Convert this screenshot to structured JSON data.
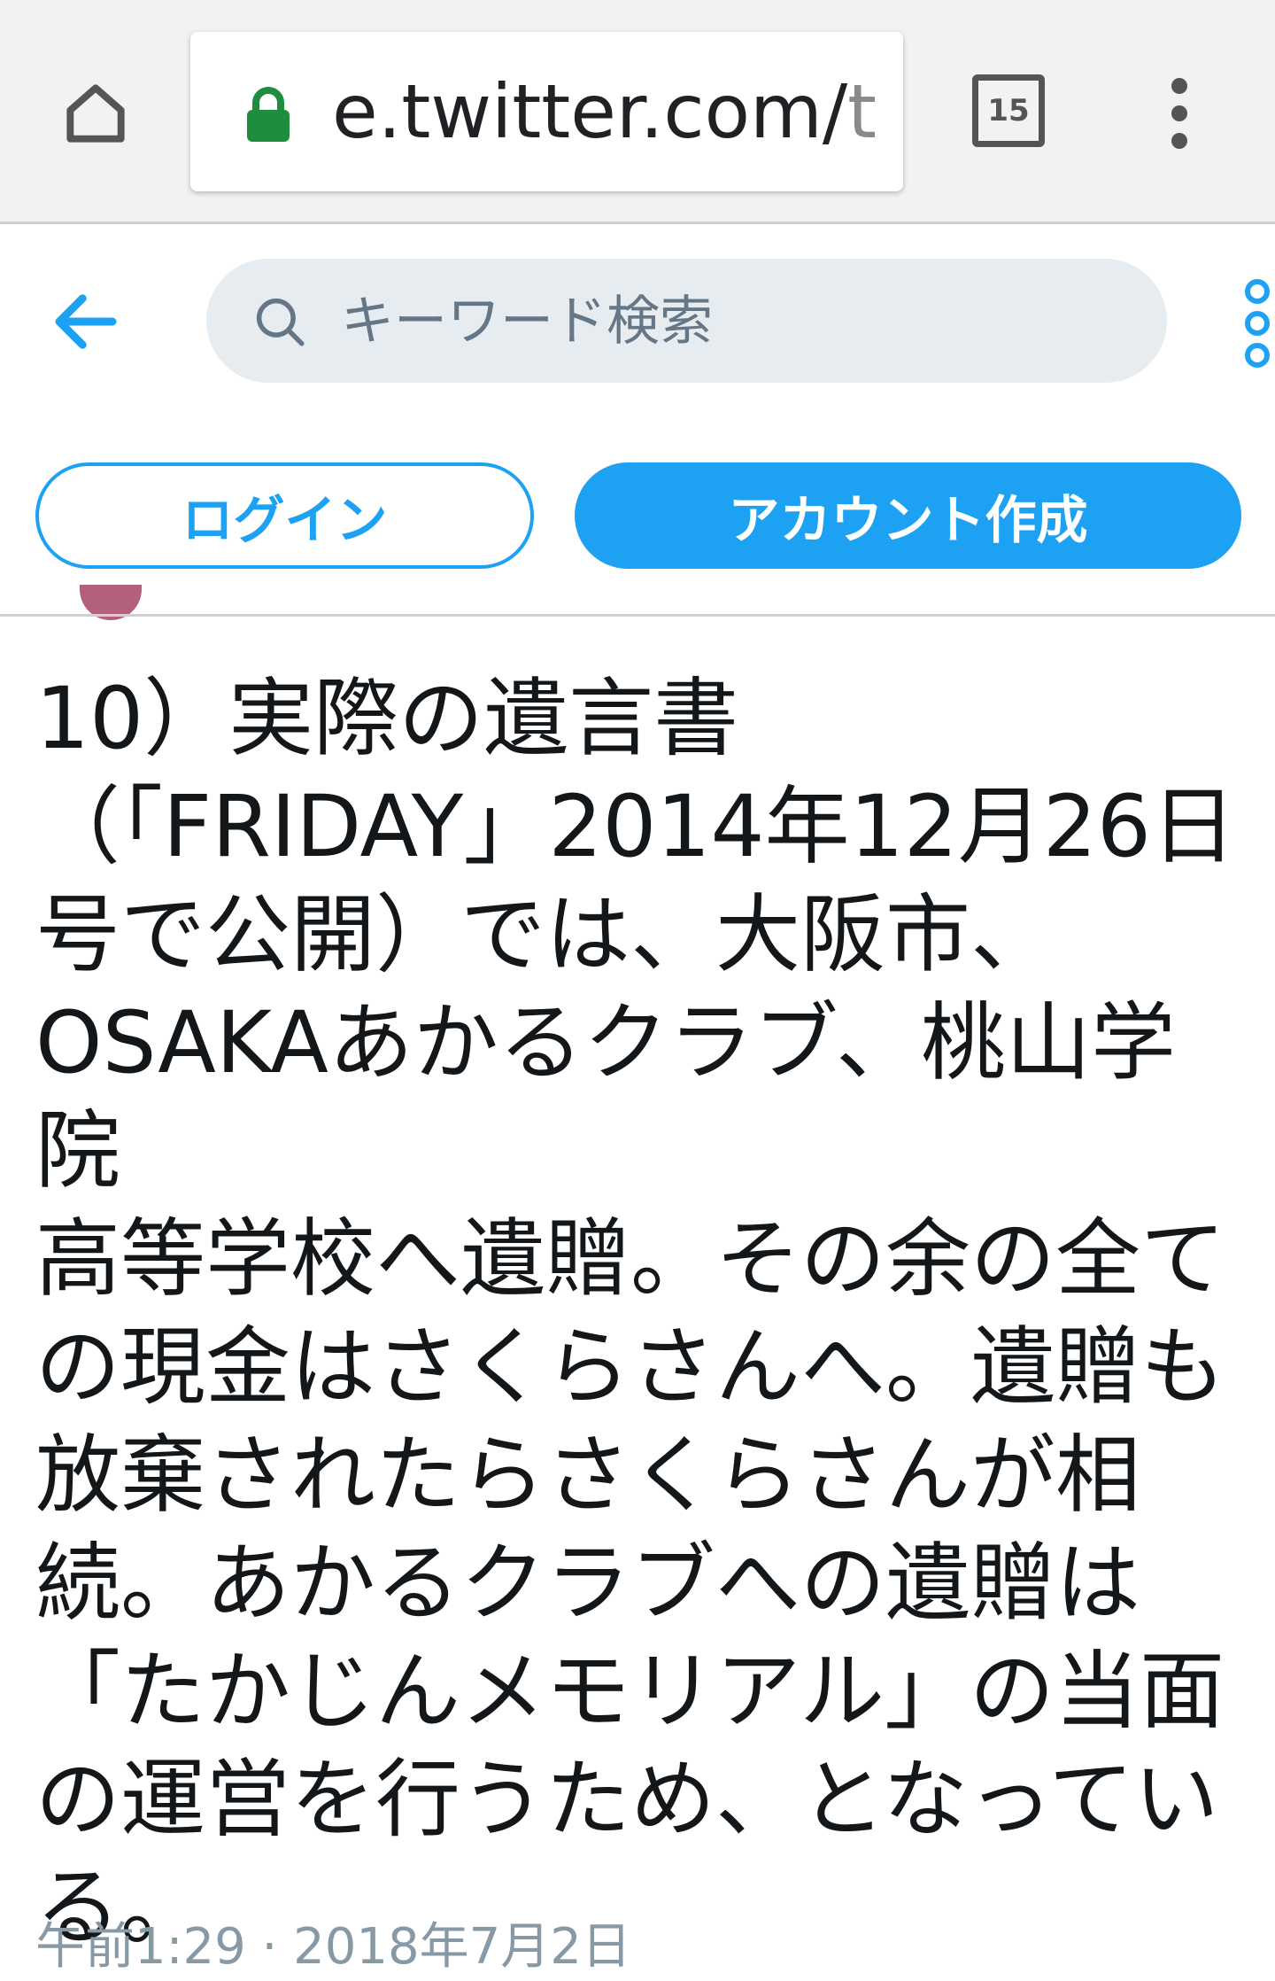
{
  "browser": {
    "url_host": "e.twitter.com/",
    "url_rest": "t",
    "tab_count": "15"
  },
  "header": {
    "search_placeholder": "キーワード検索"
  },
  "buttons": {
    "login": "ログイン",
    "signup": "アカウント作成"
  },
  "tweet": {
    "text": "10）実際の遺言書\n（「FRIDAY」2014年12月26日\n号で公開）では、大阪市、\nOSAKAあかるクラブ、桃山学院\n高等学校へ遺贈。その余の全て\nの現金はさくらさんへ。遺贈も\n放棄されたらさくらさんが相\n続。あかるクラブへの遺贈は\n「たかじんメモリアル」の当面\nの運営を行うため、となってい\nる。",
    "timestamp": "午前1:29 · 2018年7月2日"
  },
  "colors": {
    "accent": "#1da1f2",
    "lock": "#1e8e3e",
    "muted": "#8899a6"
  }
}
